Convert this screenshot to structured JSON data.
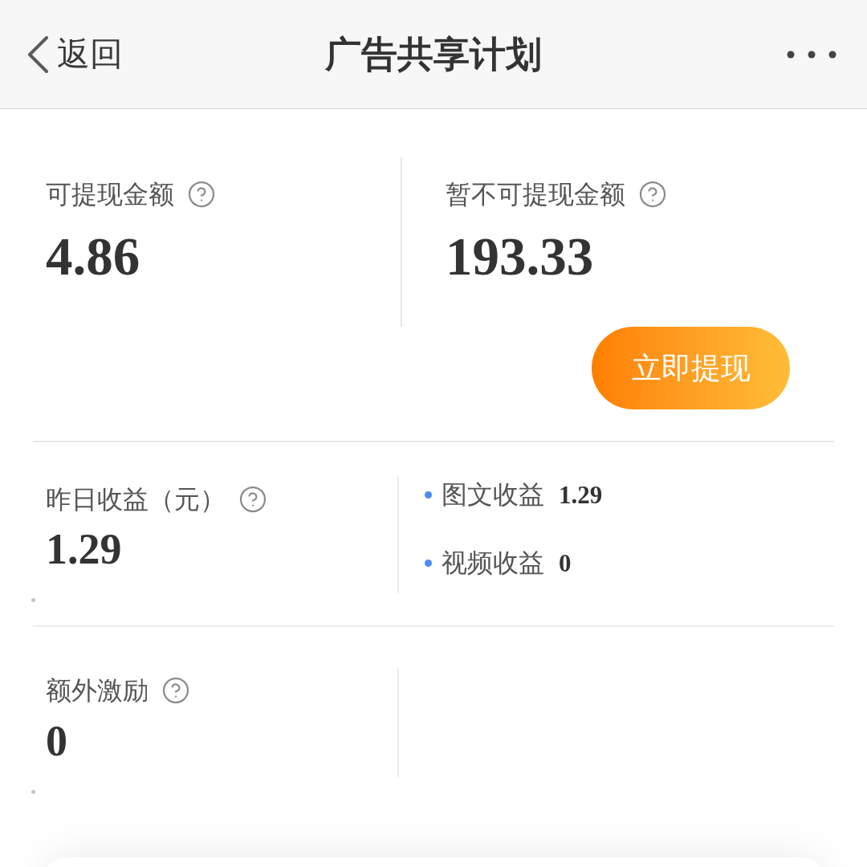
{
  "header": {
    "back_label": "返回",
    "title": "广告共享计划"
  },
  "balances": [
    {
      "label": "可提现金额",
      "amount": "4.86"
    },
    {
      "label": "暂不可提现金额",
      "amount": "193.33"
    }
  ],
  "withdraw_button": "立即提现",
  "yesterday": {
    "label": "昨日收益（元）",
    "amount": "1.29",
    "breakdown": [
      {
        "label": "图文收益",
        "amount": "1.29"
      },
      {
        "label": "视频收益",
        "amount": "0"
      }
    ]
  },
  "extra": {
    "label": "额外激励",
    "amount": "0"
  }
}
